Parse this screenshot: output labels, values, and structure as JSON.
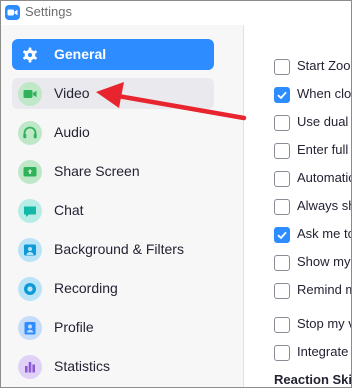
{
  "window": {
    "title": "Settings"
  },
  "sidebar": {
    "items": [
      {
        "label": "General",
        "icon": "gear-icon",
        "color": "#ffffff",
        "state": "active"
      },
      {
        "label": "Video",
        "icon": "video-camera-icon",
        "color": "#30b25a",
        "state": "hover"
      },
      {
        "label": "Audio",
        "icon": "headphones-icon",
        "color": "#30b25a",
        "state": ""
      },
      {
        "label": "Share Screen",
        "icon": "share-screen-icon",
        "color": "#30b25a",
        "state": ""
      },
      {
        "label": "Chat",
        "icon": "chat-icon",
        "color": "#14b8a6",
        "state": ""
      },
      {
        "label": "Background & Filters",
        "icon": "background-icon",
        "color": "#0e9ad6",
        "state": ""
      },
      {
        "label": "Recording",
        "icon": "recording-icon",
        "color": "#0e9ad6",
        "state": ""
      },
      {
        "label": "Profile",
        "icon": "profile-icon",
        "color": "#2d8cff",
        "state": ""
      },
      {
        "label": "Statistics",
        "icon": "statistics-icon",
        "color": "#8e59d9",
        "state": ""
      }
    ]
  },
  "options": [
    {
      "label": "Start Zoo",
      "checked": false
    },
    {
      "label": "When clo",
      "checked": true
    },
    {
      "label": "Use dual",
      "checked": false
    },
    {
      "label": "Enter full",
      "checked": false
    },
    {
      "label": "Automatic",
      "checked": false
    },
    {
      "label": "Always sh",
      "checked": false
    },
    {
      "label": "Ask me to",
      "checked": true
    },
    {
      "label": "Show my",
      "checked": false
    },
    {
      "label": "Remind m",
      "checked": false
    },
    {
      "label": "Stop my v",
      "checked": false
    },
    {
      "label": "Integrate",
      "checked": false
    }
  ],
  "section": {
    "label": "Reaction Skin"
  },
  "colors": {
    "accent": "#2d8cff",
    "annotation_arrow": "#e8252f"
  }
}
